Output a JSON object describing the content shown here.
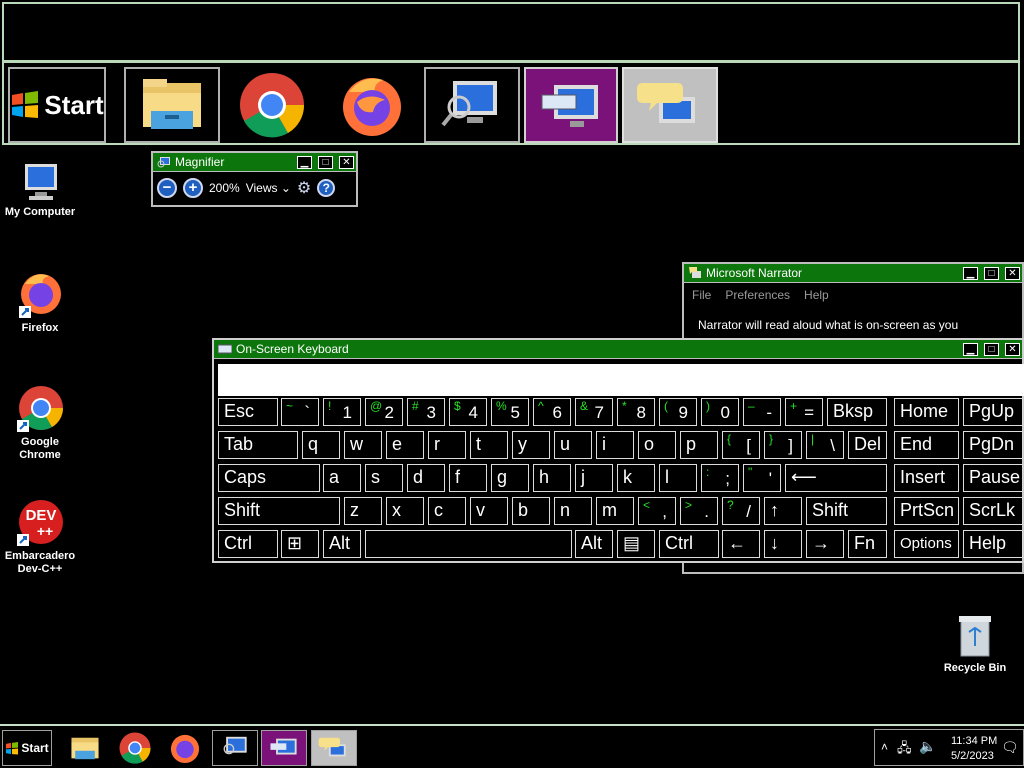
{
  "magnified_taskbar": {
    "start_label": "Start"
  },
  "desktop": {
    "icons": [
      {
        "label": "My Computer"
      },
      {
        "label": "Firefox"
      },
      {
        "label": "Google Chrome"
      },
      {
        "label": "Embarcadero Dev-C++"
      },
      {
        "label": "Recycle Bin"
      }
    ],
    "dev_logo_text": "DEV",
    "dev_logo_sub": "++"
  },
  "magnifier": {
    "title": "Magnifier",
    "zoom": "200%",
    "views_label": "Views"
  },
  "narrator": {
    "title": "Microsoft Narrator",
    "menu": [
      "File",
      "Preferences",
      "Help"
    ],
    "text": "Narrator will read aloud what is on-screen as you"
  },
  "osk": {
    "title": "On-Screen Keyboard",
    "rows": [
      [
        {
          "main": "Esc"
        },
        {
          "shift": "~",
          "lower": "`"
        },
        {
          "shift": "!",
          "lower": "1"
        },
        {
          "shift": "@",
          "lower": "2"
        },
        {
          "shift": "#",
          "lower": "3"
        },
        {
          "shift": "$",
          "lower": "4"
        },
        {
          "shift": "%",
          "lower": "5"
        },
        {
          "shift": "^",
          "lower": "6"
        },
        {
          "shift": "&",
          "lower": "7"
        },
        {
          "shift": "*",
          "lower": "8"
        },
        {
          "shift": "(",
          "lower": "9"
        },
        {
          "shift": ")",
          "lower": "0"
        },
        {
          "shift": "–",
          "lower": "-"
        },
        {
          "shift": "+",
          "lower": "="
        },
        {
          "main": "Bksp"
        },
        {
          "main": "Home"
        },
        {
          "main": "PgUp"
        }
      ],
      [
        {
          "main": "Tab"
        },
        {
          "main": "q"
        },
        {
          "main": "w"
        },
        {
          "main": "e"
        },
        {
          "main": "r"
        },
        {
          "main": "t"
        },
        {
          "main": "y"
        },
        {
          "main": "u"
        },
        {
          "main": "i"
        },
        {
          "main": "o"
        },
        {
          "main": "p"
        },
        {
          "shift": "{",
          "lower": "["
        },
        {
          "shift": "}",
          "lower": "]"
        },
        {
          "shift": "|",
          "lower": "\\"
        },
        {
          "main": "Del"
        },
        {
          "main": "End"
        },
        {
          "main": "PgDn"
        }
      ],
      [
        {
          "main": "Caps"
        },
        {
          "main": "a"
        },
        {
          "main": "s"
        },
        {
          "main": "d"
        },
        {
          "main": "f"
        },
        {
          "main": "g"
        },
        {
          "main": "h"
        },
        {
          "main": "j"
        },
        {
          "main": "k"
        },
        {
          "main": "l"
        },
        {
          "shift": ":",
          "lower": ";"
        },
        {
          "shift": "\"",
          "lower": "'"
        },
        {
          "main": "⟵"
        },
        {
          "main": "Insert"
        },
        {
          "main": "Pause"
        }
      ],
      [
        {
          "main": "Shift"
        },
        {
          "main": "z"
        },
        {
          "main": "x"
        },
        {
          "main": "c"
        },
        {
          "main": "v"
        },
        {
          "main": "b"
        },
        {
          "main": "n"
        },
        {
          "main": "m"
        },
        {
          "shift": "<",
          "lower": ","
        },
        {
          "shift": ">",
          "lower": "."
        },
        {
          "shift": "?",
          "lower": "/"
        },
        {
          "main": "↑"
        },
        {
          "main": "Shift"
        },
        {
          "main": "PrtScn"
        },
        {
          "main": "ScrLk"
        }
      ],
      [
        {
          "main": "Ctrl"
        },
        {
          "main": "⊞"
        },
        {
          "main": "Alt"
        },
        {
          "main": ""
        },
        {
          "main": "Alt"
        },
        {
          "main": "▤"
        },
        {
          "main": "Ctrl"
        },
        {
          "main": "←"
        },
        {
          "main": "↓"
        },
        {
          "main": "→"
        },
        {
          "main": "Fn"
        },
        {
          "main": "Options"
        },
        {
          "main": "Help"
        }
      ]
    ]
  },
  "taskbar": {
    "start_label": "Start",
    "time": "11:34 PM",
    "date": "5/2/2023"
  }
}
